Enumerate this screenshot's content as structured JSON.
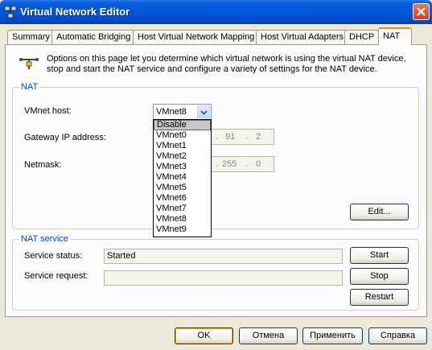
{
  "window": {
    "title": "Virtual Network Editor"
  },
  "tabs": [
    {
      "label": "Summary"
    },
    {
      "label": "Automatic Bridging"
    },
    {
      "label": "Host Virtual Network Mapping"
    },
    {
      "label": "Host Virtual Adapters"
    },
    {
      "label": "DHCP"
    },
    {
      "label": "NAT",
      "active": true
    }
  ],
  "description": "Options on this page let you determine which virtual network is using the virtual NAT device, stop and start the NAT service and configure a variety of settings for the NAT device.",
  "nat": {
    "title": "NAT",
    "vmnet_host_label": "VMnet host:",
    "vmnet_host_value": "VMnet8",
    "gateway_label": "Gateway IP address:",
    "gateway_visible": [
      ".",
      "91",
      ".",
      "2"
    ],
    "netmask_label": "Netmask:",
    "netmask_visible": [
      ".",
      "255",
      ".",
      "0"
    ],
    "edit_button": "Edit...",
    "dropdown_options": [
      "Disable",
      "VMnet0",
      "VMnet1",
      "VMnet2",
      "VMnet3",
      "VMnet4",
      "VMnet5",
      "VMnet6",
      "VMnet7",
      "VMnet8",
      "VMnet9"
    ],
    "dropdown_highlighted": "Disable"
  },
  "service": {
    "title": "NAT service",
    "status_label": "Service status:",
    "status_value": "Started",
    "request_label": "Service request:",
    "request_value": "",
    "start_button": "Start",
    "stop_button": "Stop",
    "restart_button": "Restart"
  },
  "footer": {
    "ok": "OK",
    "cancel": "Отмена",
    "apply": "Применить",
    "help": "Справка"
  },
  "colors": {
    "title_bar": "#0054e3",
    "group_title": "#0046d5",
    "active_tab_accent": "#e68b2c",
    "dialog_bg": "#ece9d8"
  },
  "icons": {
    "app": "network-editor-icon",
    "close": "close-icon",
    "nat": "nat-network-icon",
    "combo_arrow": "chevron-down-icon"
  }
}
